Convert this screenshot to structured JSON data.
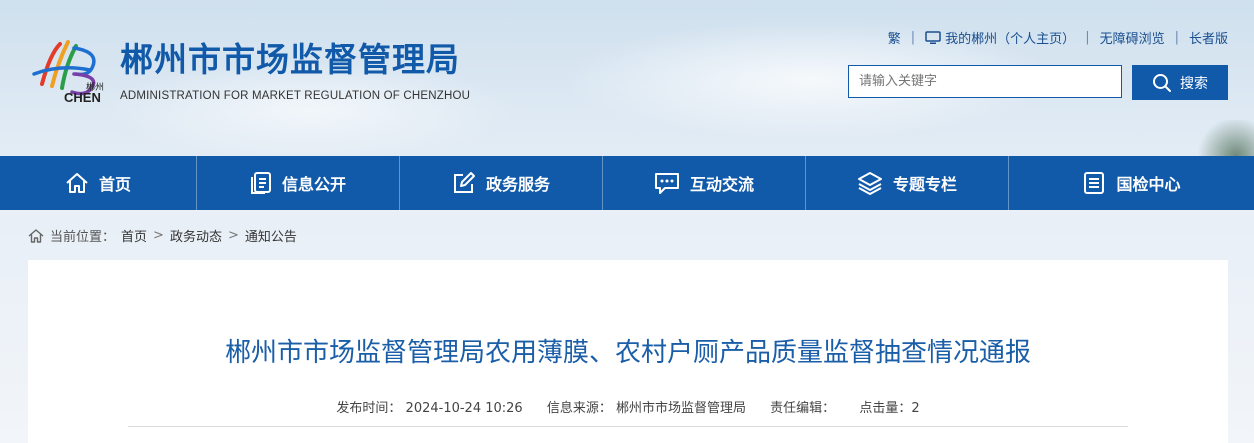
{
  "header": {
    "logo_text_cn": "郴州",
    "logo_text_en": "CHEN",
    "title": "郴州市市场监督管理局",
    "subtitle": "ADMINISTRATION FOR MARKET REGULATION OF CHENZHOU",
    "links": {
      "traditional": "繁",
      "my_chenzhou": "我的郴州（个人主页）",
      "accessibility": "无障碍浏览",
      "elder": "长者版"
    },
    "search": {
      "placeholder": "请输入关键字",
      "button_label": "搜索"
    }
  },
  "nav": {
    "items": [
      {
        "label": "首页",
        "icon": "home-icon"
      },
      {
        "label": "信息公开",
        "icon": "document-icon"
      },
      {
        "label": "政务服务",
        "icon": "edit-icon"
      },
      {
        "label": "互动交流",
        "icon": "chat-icon"
      },
      {
        "label": "专题专栏",
        "icon": "layers-icon"
      },
      {
        "label": "国检中心",
        "icon": "list-icon"
      }
    ]
  },
  "breadcrumb": {
    "prefix": "当前位置：",
    "items": [
      "首页",
      "政务动态",
      "通知公告"
    ]
  },
  "article": {
    "title": "郴州市市场监督管理局农用薄膜、农村户厕产品质量监督抽查情况通报",
    "publish_label": "发布时间：",
    "publish_time": "2024-10-24 10:26",
    "source_label": "信息来源：",
    "source": "郴州市市场监督管理局",
    "editor_label": "责任编辑：",
    "views_label": "点击量：",
    "views": "2"
  },
  "colors": {
    "brand_blue": "#1159a9",
    "title_blue": "#1a5ea8"
  }
}
